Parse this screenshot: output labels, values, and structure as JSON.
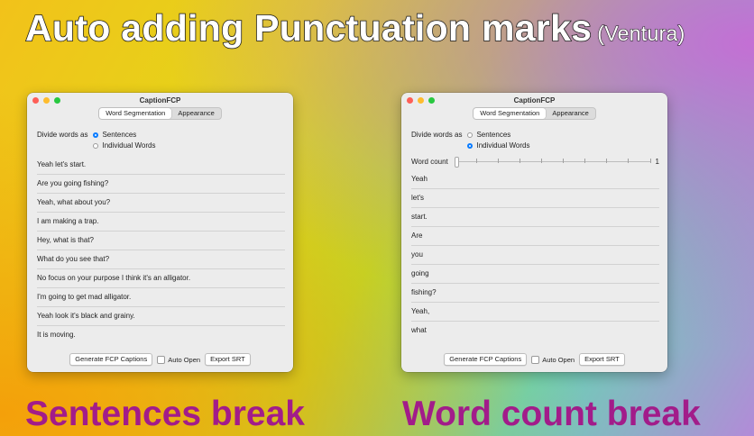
{
  "headline": {
    "main": "Auto adding Punctuation marks",
    "sub": "(Ventura)"
  },
  "captions": {
    "left": "Sentences break",
    "right": "Word count break"
  },
  "windows": [
    {
      "title": "CaptionFCP",
      "tabs": [
        "Word Segmentation",
        "Appearance"
      ],
      "divide_label": "Divide words as",
      "options": [
        "Sentences",
        "Individual Words"
      ],
      "selected": "Sentences",
      "rows": [
        "Yeah let's start.",
        "Are you going fishing?",
        "Yeah, what about you?",
        "I am making a trap.",
        "Hey, what is that?",
        "What do you see that?",
        "No focus on your purpose I think it's an alligator.",
        "I'm going to get mad alligator.",
        "Yeah look it's black and grainy.",
        "It is moving."
      ],
      "generate": "Generate FCP Captions",
      "auto_open": "Auto Open",
      "export": "Export SRT"
    },
    {
      "title": "CaptionFCP",
      "tabs": [
        "Word Segmentation",
        "Appearance"
      ],
      "divide_label": "Divide words as",
      "options": [
        "Sentences",
        "Individual Words"
      ],
      "selected": "Individual Words",
      "word_count_label": "Word count",
      "word_count_value": "1",
      "word_count_level": 0,
      "rows": [
        "Yeah",
        "let's",
        "start.",
        "Are",
        "you",
        "going",
        "fishing?",
        "Yeah,",
        "what"
      ],
      "generate": "Generate FCP Captions",
      "auto_open": "Auto Open",
      "export": "Export SRT"
    }
  ],
  "colors": {
    "caption": "#a21c8a",
    "accent": "#0a7cff"
  }
}
